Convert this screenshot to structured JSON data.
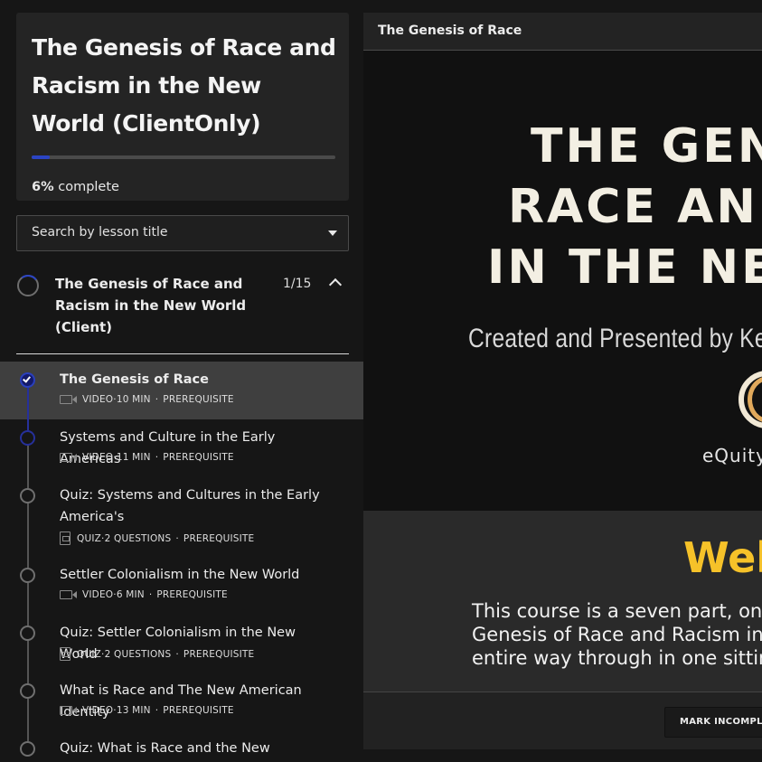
{
  "course": {
    "title": "The Genesis of Race and Racism in the New World (ClientOnly)",
    "progress_percent": 6,
    "progress_pct_label": "6%",
    "progress_suffix": "complete"
  },
  "search": {
    "label": "Search by lesson title"
  },
  "section": {
    "title": "The Genesis of Race and Racism in the New World (Client)",
    "count": "1/15"
  },
  "lessons": [
    {
      "title": "The Genesis of Race",
      "type": "VIDEO",
      "detail": "10 MIN",
      "tag": "PREREQUISITE",
      "completed": true,
      "active": true
    },
    {
      "title": "Systems and Culture in the Early Americas",
      "type": "VIDEO",
      "detail": "11 MIN",
      "tag": "PREREQUISITE"
    },
    {
      "title": "Quiz: Systems and Cultures in the Early America's",
      "type": "QUIZ",
      "detail": "2 QUESTIONS",
      "tag": "PREREQUISITE"
    },
    {
      "title": "Settler Colonialism in the New World",
      "type": "VIDEO",
      "detail": "6 MIN",
      "tag": "PREREQUISITE"
    },
    {
      "title": "Quiz: Settler Colonialism in the New World",
      "type": "QUIZ",
      "detail": "2 QUESTIONS",
      "tag": "PREREQUISITE"
    },
    {
      "title": "What is Race and The New American Identity",
      "type": "VIDEO",
      "detail": "13 MIN",
      "tag": "PREREQUISITE"
    },
    {
      "title": "Quiz: What is Race and the New American",
      "type": "QUIZ",
      "detail": "",
      "tag": ""
    }
  ],
  "main": {
    "title": "The Genesis of Race",
    "video": {
      "line1": "THE GEN",
      "line2": "RACE AN",
      "line3": "IN THE NE",
      "subtitle": "Created and Presented by Ke",
      "logo_text": "eQuity"
    },
    "welcome": "Welc",
    "body_line1": "This course is a seven part, one h",
    "body_line2": "Genesis of Race and Racism in th",
    "body_line3": "entire way through in one sitting",
    "mark_button": "MARK INCOMPLETE"
  },
  "colors": {
    "accent": "#2b44c4",
    "welcome_yellow": "#f6c229",
    "logo_orange": "#e1a95b"
  }
}
